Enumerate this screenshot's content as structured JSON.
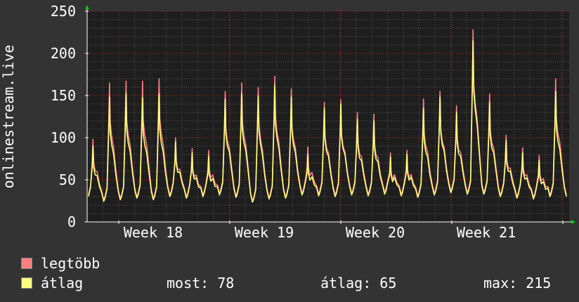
{
  "chart_data": {
    "type": "line",
    "ylabel": "onlinestream.live",
    "ylim": [
      0,
      250
    ],
    "yticks": [
      0,
      50,
      100,
      150,
      200,
      250
    ],
    "xticks": [
      "Week 18",
      "Week 19",
      "Week 20",
      "Week 21"
    ],
    "grid": true,
    "series": [
      {
        "name": "legtöbb",
        "color": "#ff7f7f",
        "peaks": [
          98,
          165,
          167,
          167,
          170,
          100,
          87,
          85,
          155,
          165,
          160,
          173,
          158,
          89,
          142,
          145,
          130,
          128,
          82,
          85,
          146,
          155,
          138,
          228,
          152,
          103,
          88,
          79,
          170
        ]
      },
      {
        "name": "átlag",
        "color": "#ffff7f",
        "peaks": [
          90,
          148,
          152,
          147,
          152,
          95,
          82,
          78,
          146,
          152,
          150,
          162,
          148,
          80,
          135,
          140,
          122,
          120,
          77,
          80,
          135,
          148,
          130,
          215,
          142,
          97,
          82,
          73,
          155
        ]
      }
    ],
    "troughs": [
      28,
      26,
      28,
      30,
      28,
      32,
      30,
      32,
      34,
      31,
      25,
      29,
      30,
      34,
      33,
      32,
      34,
      33,
      35,
      33,
      31,
      34,
      37,
      35,
      35,
      32,
      30,
      29,
      32
    ]
  },
  "legend": {
    "max_label": "legtöbb",
    "avg_label": "átlag",
    "now_text": "most: 78",
    "avg_text": "átlag: 65",
    "max_text": "max: 215"
  },
  "colors": {
    "background": "#333333",
    "plot_bg": "#1e1e1e",
    "grid_major": "#b22222",
    "grid_minor": "#555555",
    "axis": "#ffffff",
    "arrow": "#00cc00"
  }
}
